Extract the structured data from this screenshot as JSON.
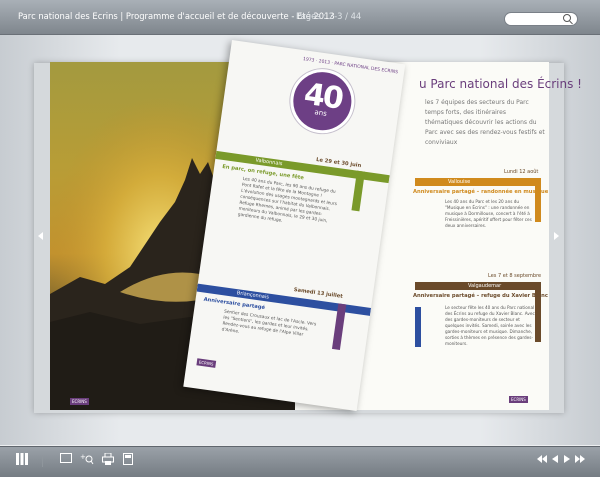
{
  "header": {
    "title": "Parc national des Ecrins | Programme d'accueil et de découverte - Eté 2013",
    "pages": "Pages : 2-3 / 44",
    "search_placeholder": ""
  },
  "right_page": {
    "title": "u Parc national des Écrins !",
    "intro": "les 7 équipes des secteurs du Parc temps forts, des itinéraires thématiques découvrir les actions du Parc avec ses des rendez-vous festifs et conviviaux",
    "blocks": [
      {
        "head": "Lundi 12 août",
        "tag": "Vallouise",
        "label": "Anniversaire partagé – randonnée en musique",
        "text": "Les 40 ans du Parc et les 20 ans du \"Musique en Écrins\" : une randonnée en musique à Dormillouse, concert à l'été à Freissinières, apéritif offert pour fêter ces deux anniversaires."
      },
      {
        "head": "Les 7 et 8 septembre",
        "tag": "Valgaudemar",
        "label": "Anniversaire partagé – refuge du Xavier Blanc",
        "text": "Le secteur fête les 40 ans du Parc national des Écrins au refuge du Xavier Blanc. Avec des gardes-moniteurs de secteur et quelques invités. Samedi, soirée avec les gardes-moniteurs et musique. Dimanche, sorties à thèmes en présence des gardes-moniteurs."
      }
    ],
    "corner_tag": "ECRINS"
  },
  "leaf": {
    "logo_years": "1973 · 2013 · PARC NATIONAL DES ECRINS",
    "logo_number": "40",
    "logo_unit": "ans",
    "blocks": [
      {
        "head": "Le 29 et 30 juin",
        "tag": "Valbonnais",
        "label": "En parc, on refuge, une fête",
        "text": "Les 40 ans du Parc, les 90 ans du refuge du Pont Rafet et la fête de la Montagne ! L'évolution des usages montagnards et leurs conséquences sur l'habitat du Valbonnais. Refuge Rhemes, animé par les gardes-moniteurs du Valbonnais, le 29 et 30 juin, gardienne du refuge."
      },
      {
        "head": "Samedi 13 juillet",
        "tag": "Briançonnais",
        "label": "Anniversaire partagé",
        "text": "Sentier des Crousaux et lac de l'Ascle. Vers les \"Sentiers\", les gardes et leur invités. Rendez-vous au refuge de l'Alpe Villar d'Arène."
      }
    ],
    "corner_tag": "ECRINS"
  },
  "left_page": {
    "corner_tag": "ECRINS"
  },
  "toolbar": {
    "left_icons": [
      "grid-icon",
      "fullscreen-icon",
      "zoom-in-icon",
      "print-icon",
      "save-icon"
    ],
    "right_icons": [
      "first-page-icon",
      "prev-page-icon",
      "next-page-icon",
      "last-page-icon"
    ]
  },
  "colors": {
    "accent": "#6d3f85",
    "green": "#7a9a2a",
    "orange": "#d08a1d",
    "brown": "#6a4a2a",
    "blue": "#2d4fa0",
    "purple": "#6a3e7c"
  }
}
